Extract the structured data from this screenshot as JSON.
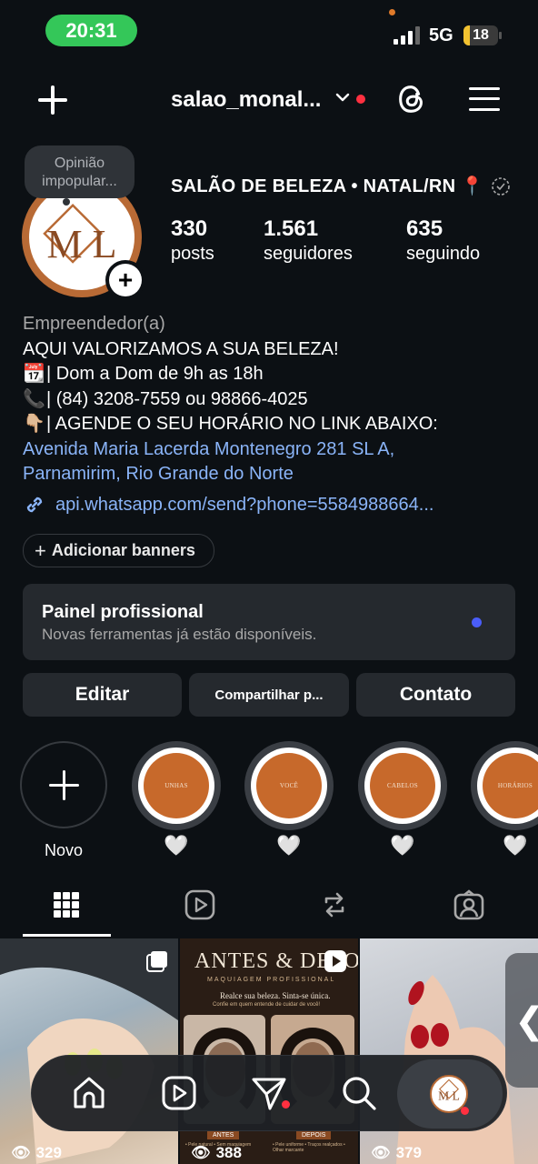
{
  "status_bar": {
    "time": "20:31",
    "network": "5G",
    "battery": "18",
    "battery_level": 0.18
  },
  "header": {
    "username": "salao_monal...",
    "has_notification": true
  },
  "profile": {
    "note": "Opinião impopular...",
    "display_name": "SALÃO DE BELEZA • NATAL/RN",
    "pin_emoji": "📍",
    "avatar_monogram": "M L",
    "stats": [
      {
        "number": "330",
        "label": "posts"
      },
      {
        "number": "1.561",
        "label": "seguidores"
      },
      {
        "number": "635",
        "label": "seguindo"
      }
    ],
    "category": "Empreendedor(a)",
    "bio_lines": [
      {
        "emoji": "",
        "text": "AQUI VALORIZAMOS A SUA BELEZA!"
      },
      {
        "emoji": "📆",
        "text": "| Dom a Dom de 9h as 18h"
      },
      {
        "emoji": "📞",
        "text": "| (84) 3208-7559 ou 98866-4025"
      },
      {
        "emoji": "👇🏼",
        "text": "| AGENDE O SEU HORÁRIO NO LINK ABAIXO:"
      }
    ],
    "address_line1": "Avenida Maria Lacerda Montenegro 281 SL A,",
    "address_line2": "Parnamirim, Rio Grande do Norte",
    "link": "api.whatsapp.com/send?phone=5584988664..."
  },
  "banner_button": {
    "plus": "+",
    "label": "Adicionar banners"
  },
  "pro_panel": {
    "title": "Painel profissional",
    "subtitle": "Novas ferramentas já estão disponíveis."
  },
  "actions": {
    "edit": "Editar",
    "share": "Compartilhar p...",
    "contact": "Contato"
  },
  "highlights": [
    {
      "label": "Novo"
    },
    {
      "cover": "UNHAS"
    },
    {
      "cover": "VOCÊ"
    },
    {
      "cover": "CABELOS"
    },
    {
      "cover": "HORÁRIOS"
    }
  ],
  "heart": "🤍",
  "grid_posts": [
    {
      "views": "329"
    },
    {
      "views": "388",
      "title": "ANTES & DEPOI",
      "subtitle": "MAQUIAGEM PROFISSIONAL",
      "tagline": "Realce sua beleza. Sinta-se única.",
      "tagline2": "Confie em quem entende de cuidar de você!",
      "before_label": "ANTES",
      "after_label": "DEPOIS",
      "before_note": "• Pele natural • Sem maquiagem",
      "after_note": "• Pele uniforme • Traços realçados • Olhar marcante"
    },
    {
      "views": "379"
    }
  ],
  "icons": {
    "back_arrow": "❮",
    "eye": "👁"
  },
  "colors": {
    "accent_blue": "#8ab4f8",
    "notification_red": "#ff3040",
    "brand_copper": "#c7692b",
    "clock_green": "#34c759"
  }
}
